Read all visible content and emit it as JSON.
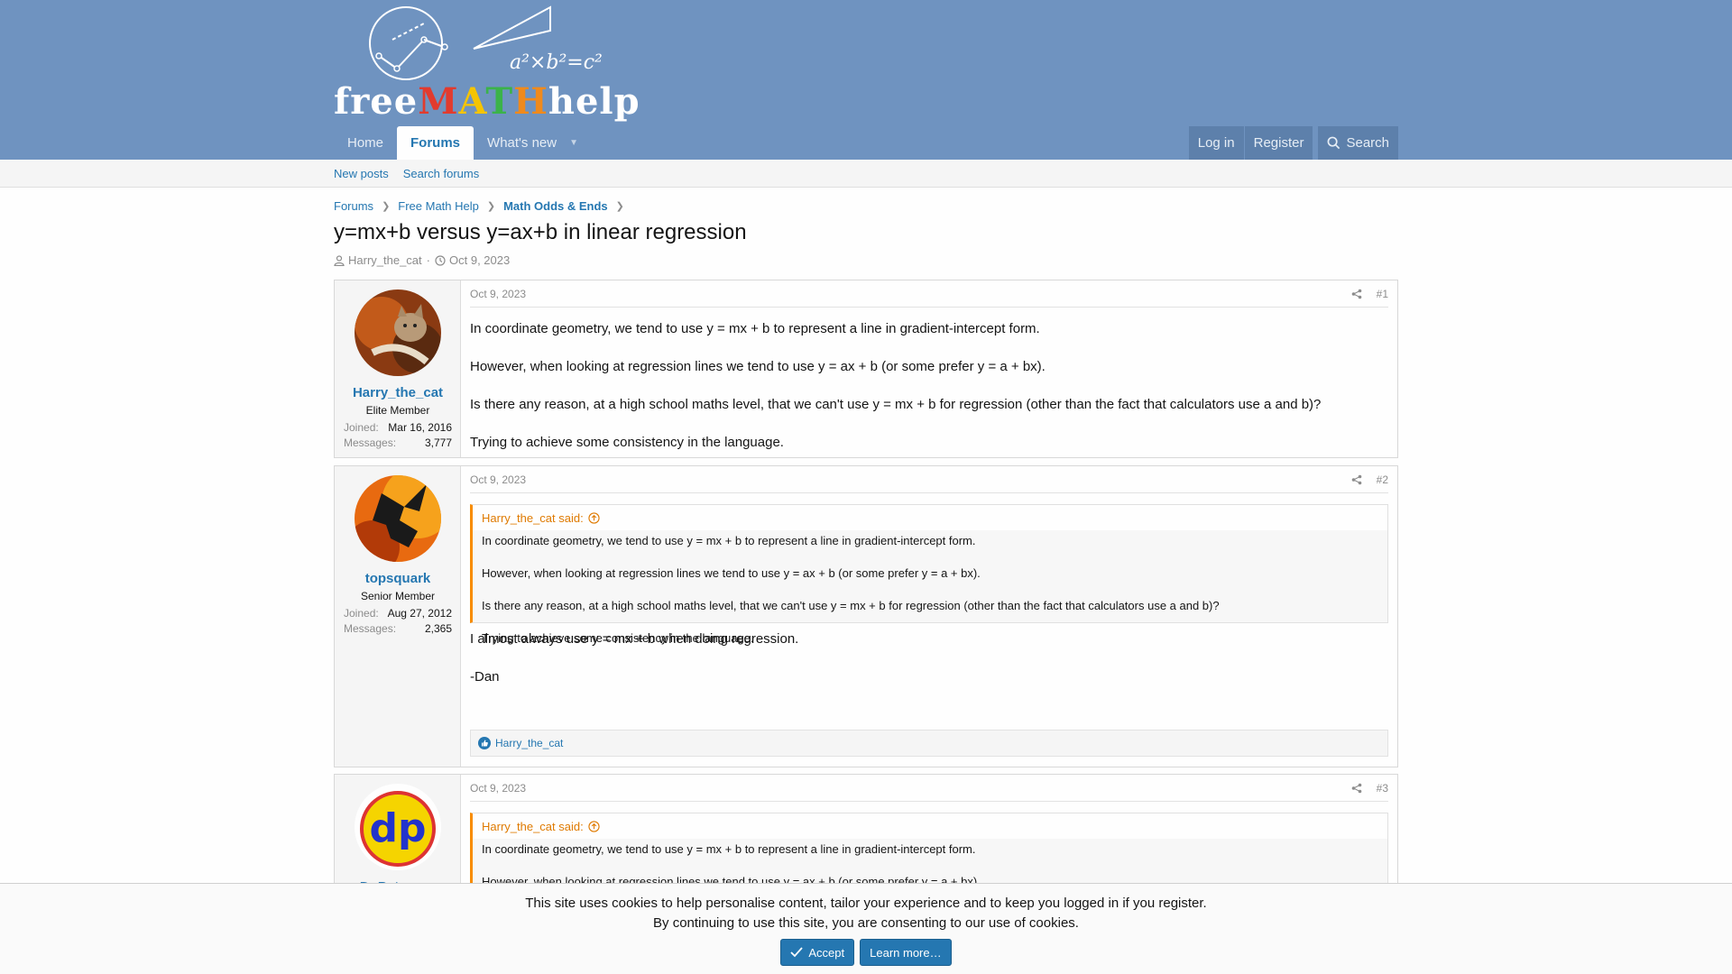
{
  "site": {
    "logo_text": "freeMATHhelp",
    "logo_formula": "a²×b²=c²"
  },
  "nav": {
    "tabs": [
      {
        "label": "Home"
      },
      {
        "label": "Forums"
      },
      {
        "label": "What's new"
      }
    ],
    "login": "Log in",
    "register": "Register",
    "search": "Search"
  },
  "subnav": {
    "new_posts": "New posts",
    "search_forums": "Search forums"
  },
  "breadcrumb": [
    "Forums",
    "Free Math Help",
    "Math Odds & Ends"
  ],
  "thread": {
    "title": "y=mx+b versus y=ax+b in linear regression",
    "author": "Harry_the_cat",
    "date": "Oct 9, 2023"
  },
  "posts": [
    {
      "user": {
        "name": "Harry_the_cat",
        "title": "Elite Member",
        "joined_label": "Joined:",
        "joined": "Mar 16, 2016",
        "messages_label": "Messages:",
        "messages": "3,777"
      },
      "date": "Oct 9, 2023",
      "num": "#1",
      "paragraphs": [
        "In coordinate geometry, we tend to use y = mx + b to represent a line in gradient-intercept form.",
        "However, when looking at regression lines we tend to use y = ax + b (or some prefer y = a + bx).",
        "Is there any reason, at a high school maths level, that we can't use y = mx + b for regression (other than the fact that calculators use a and b)?",
        "Trying to achieve some consistency in the language."
      ]
    },
    {
      "user": {
        "name": "topsquark",
        "title": "Senior Member",
        "joined_label": "Joined:",
        "joined": "Aug 27, 2012",
        "messages_label": "Messages:",
        "messages": "2,365"
      },
      "date": "Oct 9, 2023",
      "num": "#2",
      "quote_head": "Harry_the_cat said:",
      "quote": [
        "In coordinate geometry, we tend to use y = mx + b to represent a line in gradient-intercept form.",
        "However, when looking at regression lines we tend to use y = ax + b (or some prefer y = a + bx).",
        "Is there any reason, at a high school maths level, that we can't use y = mx + b for regression (other than the fact that calculators use a and b)?",
        "Trying to achieve some consistency in the language."
      ],
      "paragraphs": [
        "I almost always use y = mx + b when doing regression.",
        "-Dan"
      ],
      "reaction": "Harry_the_cat"
    },
    {
      "user": {
        "name": "Dr.Peterson",
        "avatar_text": "dp"
      },
      "date": "Oct 9, 2023",
      "num": "#3",
      "quote_head": "Harry_the_cat said:",
      "quote": [
        "In coordinate geometry, we tend to use y = mx + b to represent a line in gradient-intercept form.",
        "However, when looking at regression lines we tend to use y = ax + b (or some prefer y = a + bx)."
      ]
    }
  ],
  "cookie": {
    "line1": "This site uses cookies to help personalise content, tailor your experience and to keep you logged in if you register.",
    "line2": "By continuing to use this site, you are consenting to our use of cookies.",
    "accept": "Accept",
    "learn_more": "Learn more…"
  },
  "colors": {
    "header": "#6f93c0",
    "link": "#2577b1",
    "quote_accent": "#f88c00"
  }
}
